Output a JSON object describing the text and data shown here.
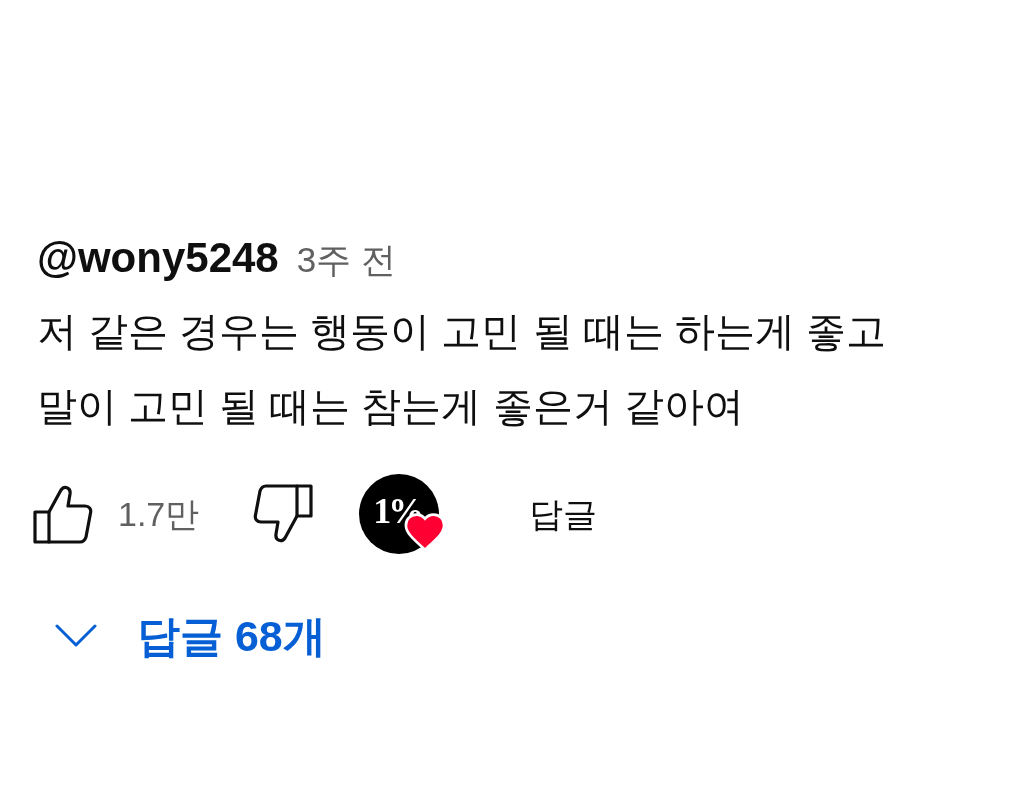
{
  "comment": {
    "author": "@wony5248",
    "time": "3주 전",
    "text": "저 같은 경우는 행동이 고민 될 때는 하는게 좋고\n말이 고민 될 때는 참는게 좋은거 같아여"
  },
  "actions": {
    "liked": false,
    "like_count": "1.7만",
    "disliked": false,
    "creator_heart": {
      "hearted": true,
      "avatar_text": "1%"
    },
    "reply_label": "답글"
  },
  "replies_toggle": {
    "expanded": false,
    "label": "답글 68개"
  }
}
